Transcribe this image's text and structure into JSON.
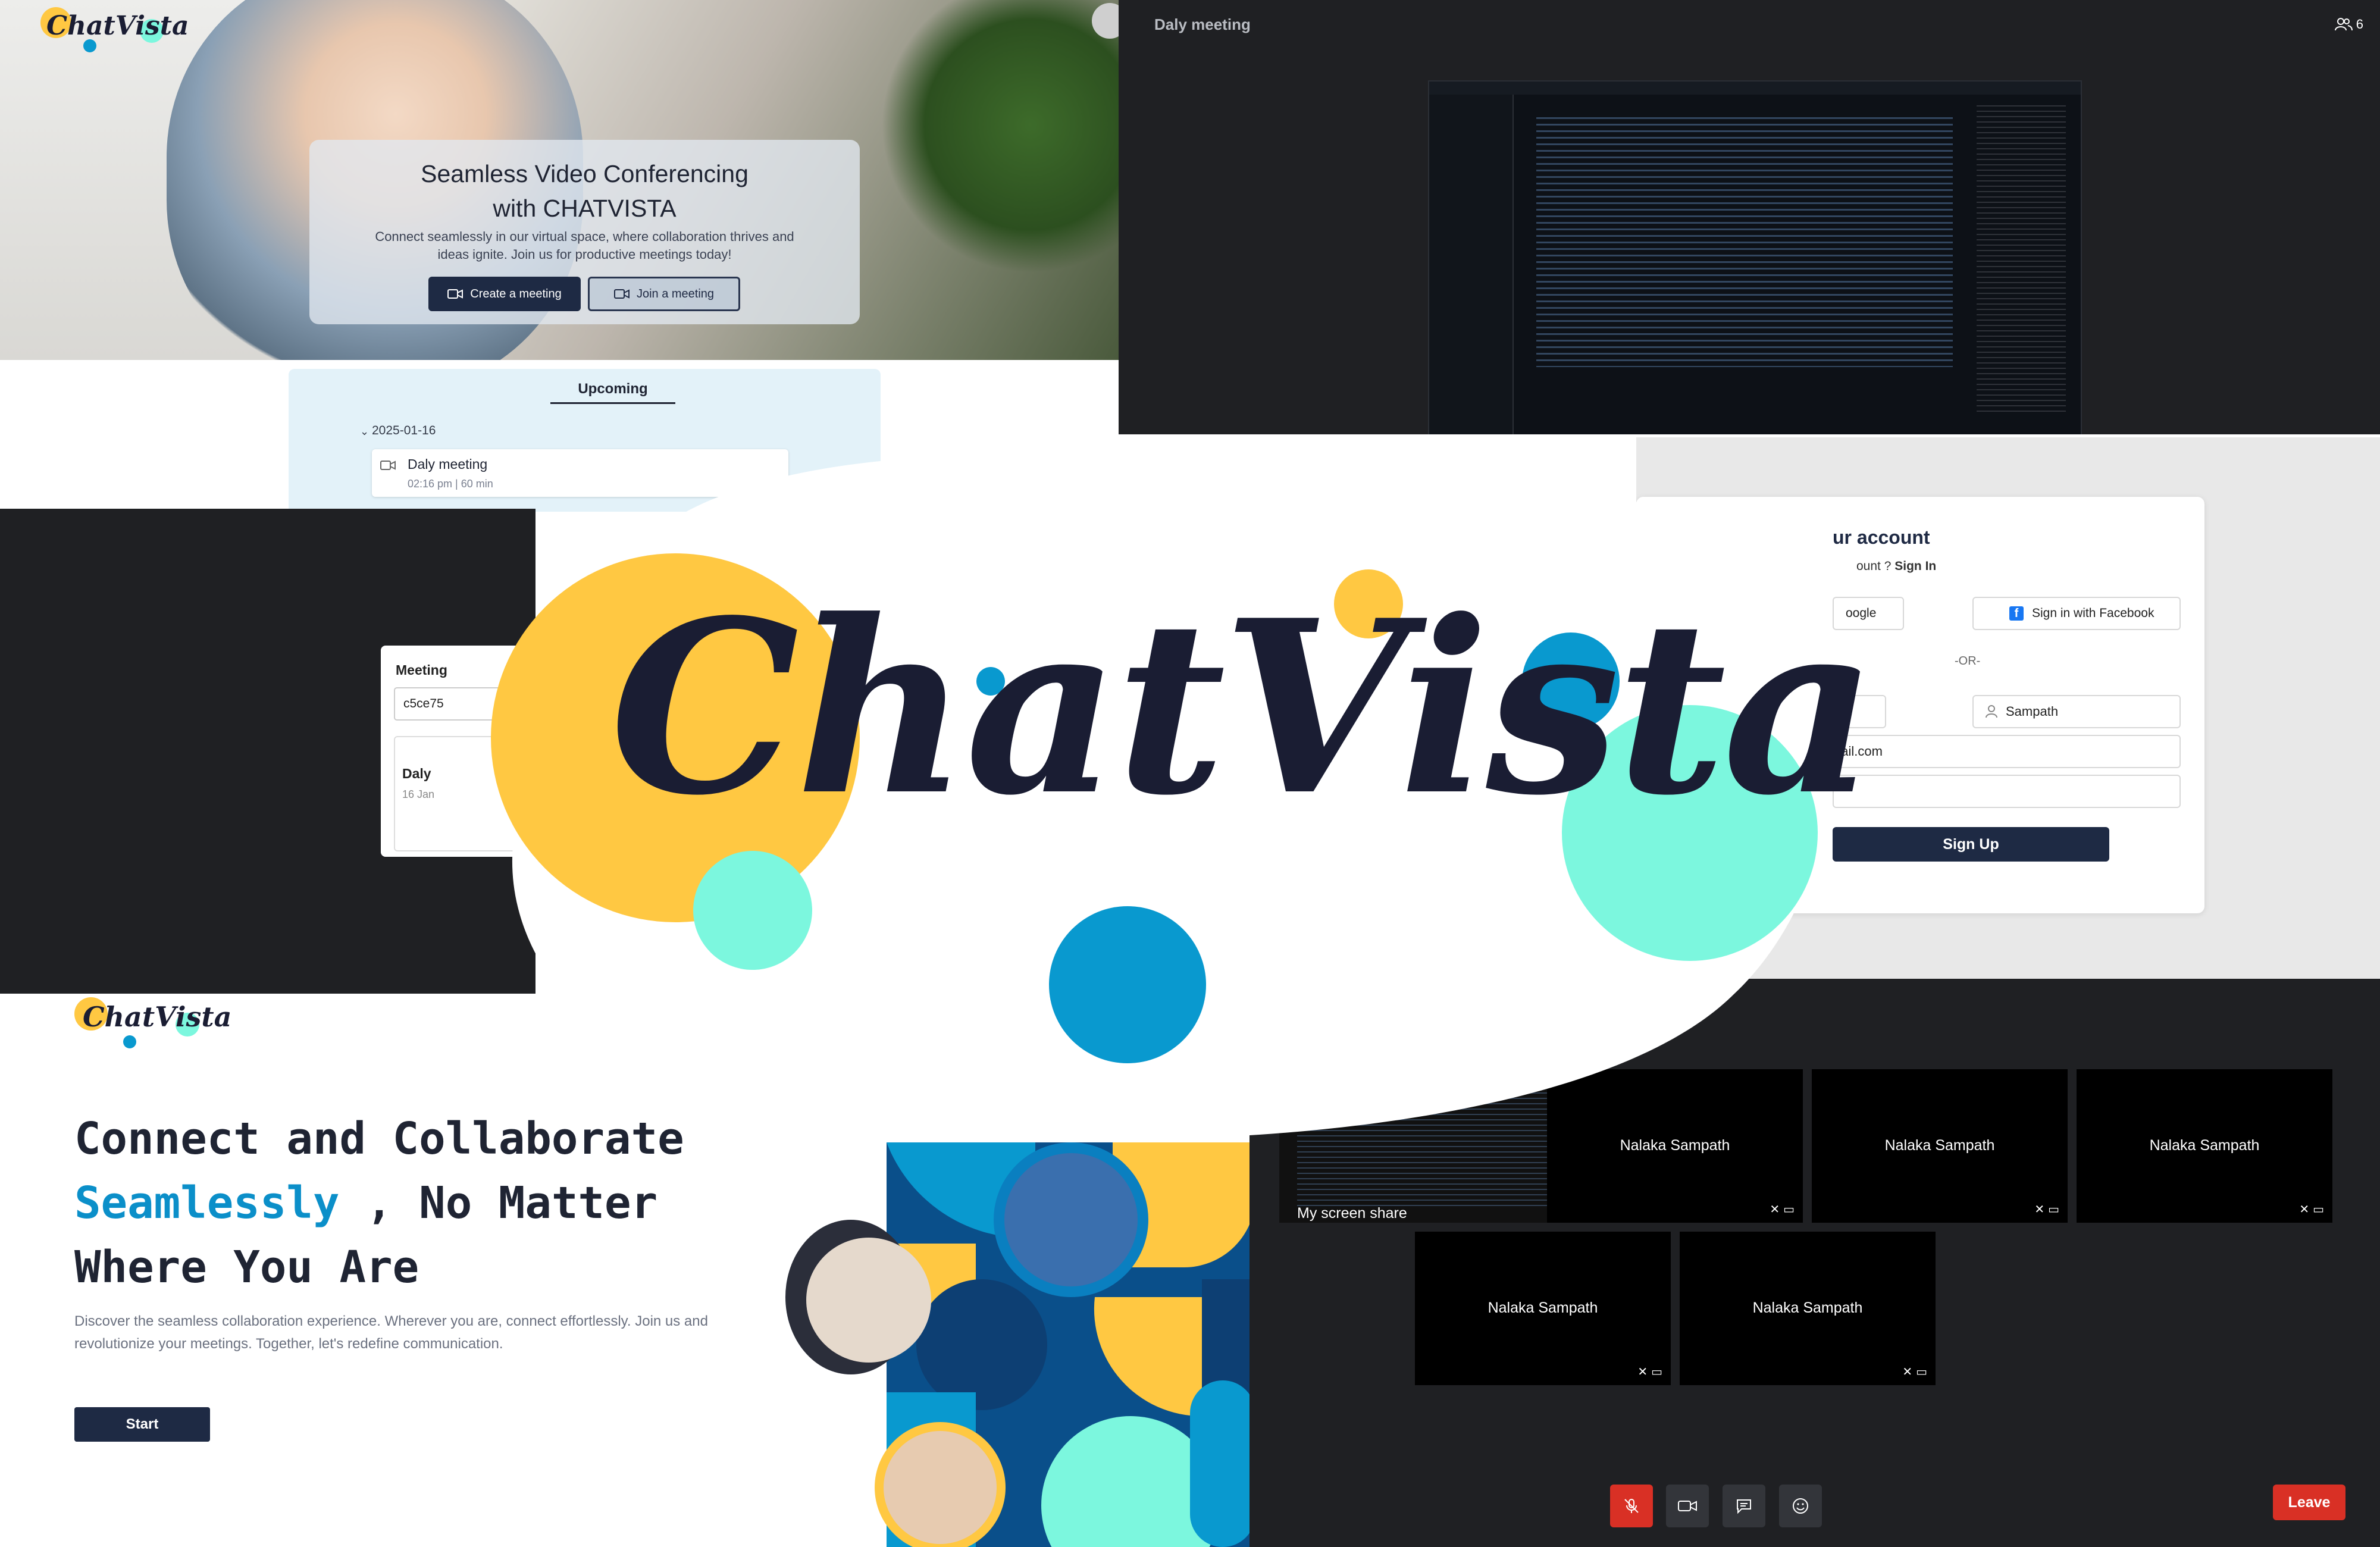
{
  "colors": {
    "navy": "#1e2a44",
    "ink": "#1a1d33",
    "yellow": "#ffc842",
    "aqua": "#7cf7de",
    "blue": "#0999cf",
    "dark_bg": "#1f2023",
    "leave_red": "#d93025",
    "accent_blue": "#0b8fc9"
  },
  "brand": {
    "name": "ChatVista"
  },
  "hero": {
    "title_line1": "Seamless Video Conferencing",
    "title_line2": "with CHATVISTA",
    "subtitle": "Connect seamlessly in our virtual space, where collaboration thrives and ideas ignite. Join us for productive meetings today!",
    "create_label": "Create a meeting",
    "join_label": "Join a meeting",
    "create_icon": "video-camera-icon",
    "join_icon": "video-camera-icon"
  },
  "upcoming": {
    "tab_label": "Upcoming",
    "date": "2025-01-16",
    "item": {
      "title": "Daly meeting",
      "meta": "02:16 pm | 60 min"
    }
  },
  "meeting": {
    "title": "Daly meeting",
    "participant_count": "6"
  },
  "signup": {
    "title": "ur account",
    "question": "ount ? ",
    "signin_link": "Sign In",
    "google_label": "oogle",
    "facebook_label": "Sign in with Facebook",
    "or_label": "-OR-",
    "last_name_value": "Sampath",
    "email_value": "nail.com",
    "submit_label": "Sign Up"
  },
  "meeting_card": {
    "label": "Meeting",
    "code_value": "c5ce75",
    "item_title": "Daly ",
    "item_date": "16 Jan"
  },
  "landing": {
    "headline_line1": "Connect and Collaborate",
    "headline_accent": "Seamlessly",
    "headline_line2_rest": " , No Matter",
    "headline_line3": "Where You Are",
    "description_line1": "Discover the seamless collaboration experience. Wherever you are, connect effortlessly. Join us and",
    "description_line2": "revolutionize your meetings. Together, let's redefine communication.",
    "start_label": "Start"
  },
  "video_grid": {
    "screen_share_label": "My screen share",
    "tiles": [
      "Nalaka Sampath",
      "Nalaka Sampath",
      "Nalaka Sampath",
      "Nalaka Sampath",
      "Nalaka Sampath"
    ],
    "leave_label": "Leave",
    "controls": [
      "mic-off-icon",
      "video-camera-icon",
      "chat-icon",
      "emoji-icon"
    ]
  }
}
